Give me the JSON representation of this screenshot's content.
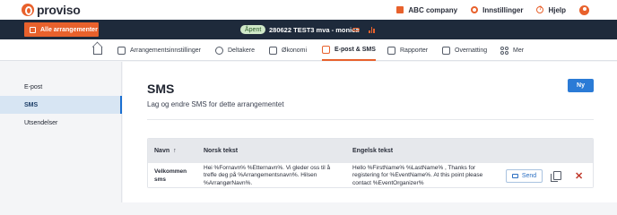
{
  "app": {
    "logo_text": "proviso"
  },
  "top_nav": {
    "company": "ABC company",
    "settings": "Innstillinger",
    "help": "Hjelp"
  },
  "event_bar": {
    "all_events_label": "Alle arrangementer",
    "status": "Åpent",
    "event_title": "280622 TEST3 mva - monica"
  },
  "tabs": [
    {
      "label": "Arrangementsinnstillinger"
    },
    {
      "label": "Deltakere"
    },
    {
      "label": "Økonomi"
    },
    {
      "label": "E-post & SMS",
      "active": true
    },
    {
      "label": "Rapporter"
    },
    {
      "label": "Overnatting"
    },
    {
      "label": "Mer"
    }
  ],
  "sidebar": {
    "items": [
      {
        "label": "E-post"
      },
      {
        "label": "SMS",
        "active": true
      },
      {
        "label": "Utsendelser"
      }
    ]
  },
  "main": {
    "title": "SMS",
    "subtitle": "Lag og endre SMS for dette arrangementet",
    "new_button": "Ny"
  },
  "table": {
    "headers": {
      "name": "Navn",
      "sort_glyph": "↑",
      "norwegian": "Norsk tekst",
      "english": "Engelsk tekst"
    },
    "rows": [
      {
        "name_line1": "Velkommen",
        "name_line2": "sms",
        "norwegian_line1": "Hei %Fornavn% %Etternavn%. Vi gleder oss til å",
        "norwegian_line2": "treffe deg på %Arrangementsnavn%. Hilsen",
        "norwegian_line3": "%ArrangørNavn%.",
        "english_line1": "Hello %FirstName% %LastName% , Thanks for",
        "english_line2": "registering for %EventName%. At this point please",
        "english_line3": "contact %EventOrganizer%",
        "send_label": "Send",
        "delete_glyph": "✕"
      }
    ]
  },
  "colors": {
    "accent": "#e8612c",
    "primary": "#2b7bd6",
    "dark_bar": "#1e2a3b"
  }
}
